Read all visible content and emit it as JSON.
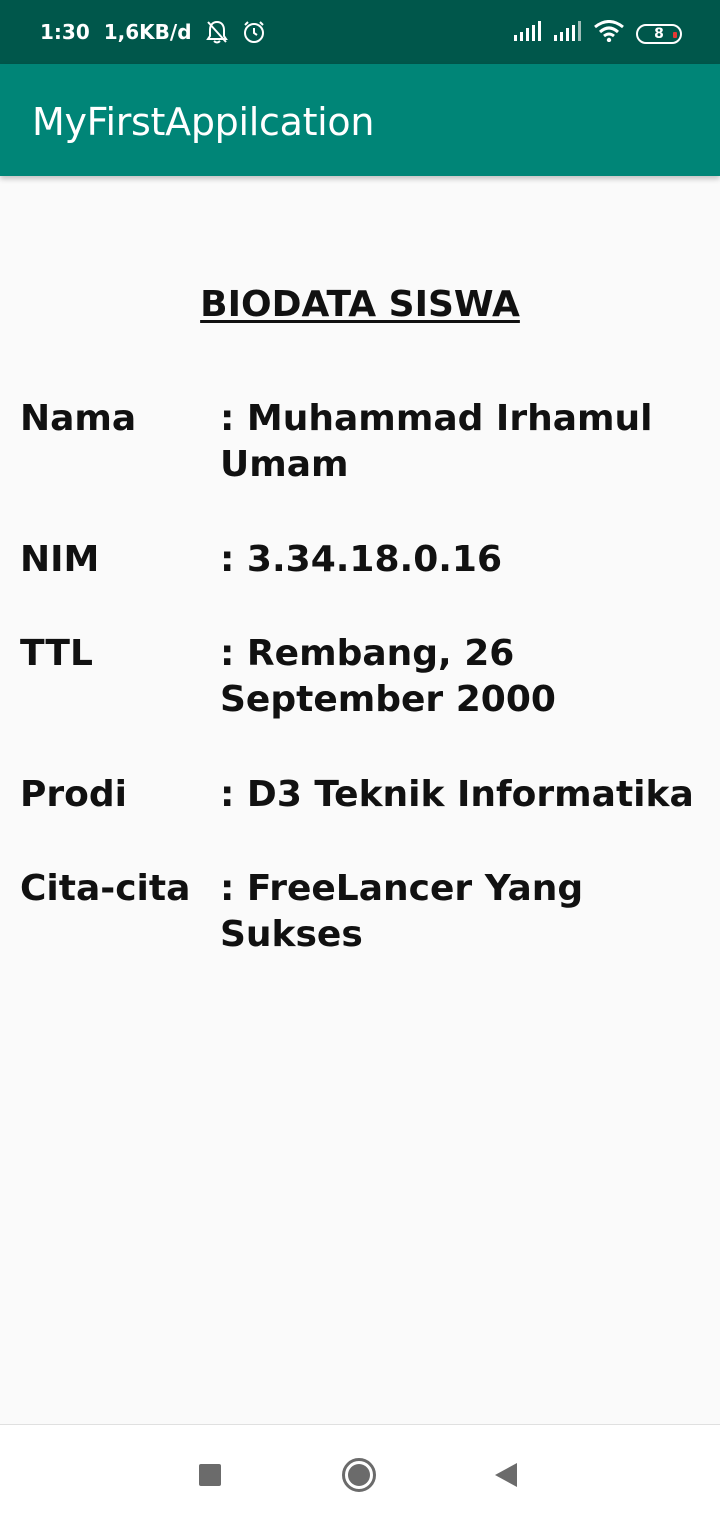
{
  "status_bar": {
    "time": "1:30",
    "data_speed": "1,6KB/d",
    "icons": [
      "bell-off-icon",
      "alarm-icon",
      "signal-icon",
      "signal-icon",
      "wifi-icon",
      "battery-icon"
    ],
    "battery_level": "8",
    "background": "#00574b"
  },
  "app_bar": {
    "title": "MyFirstAppilcation",
    "background": "#008577"
  },
  "main": {
    "heading": "BIODATA SISWA",
    "rows": [
      {
        "label": "Nama",
        "value": ": Muhammad Irhamul Umam"
      },
      {
        "label": "NIM",
        "value": ": 3.34.18.0.16"
      },
      {
        "label": "TTL",
        "value": ": Rembang, 26 September 2000"
      },
      {
        "label": "Prodi",
        "value": ": D3 Teknik Informatika"
      },
      {
        "label": "Cita-cita",
        "value": ": FreeLancer Yang Sukses"
      }
    ]
  },
  "nav_bar": {
    "buttons": [
      "recents-button",
      "home-button",
      "back-button"
    ]
  }
}
